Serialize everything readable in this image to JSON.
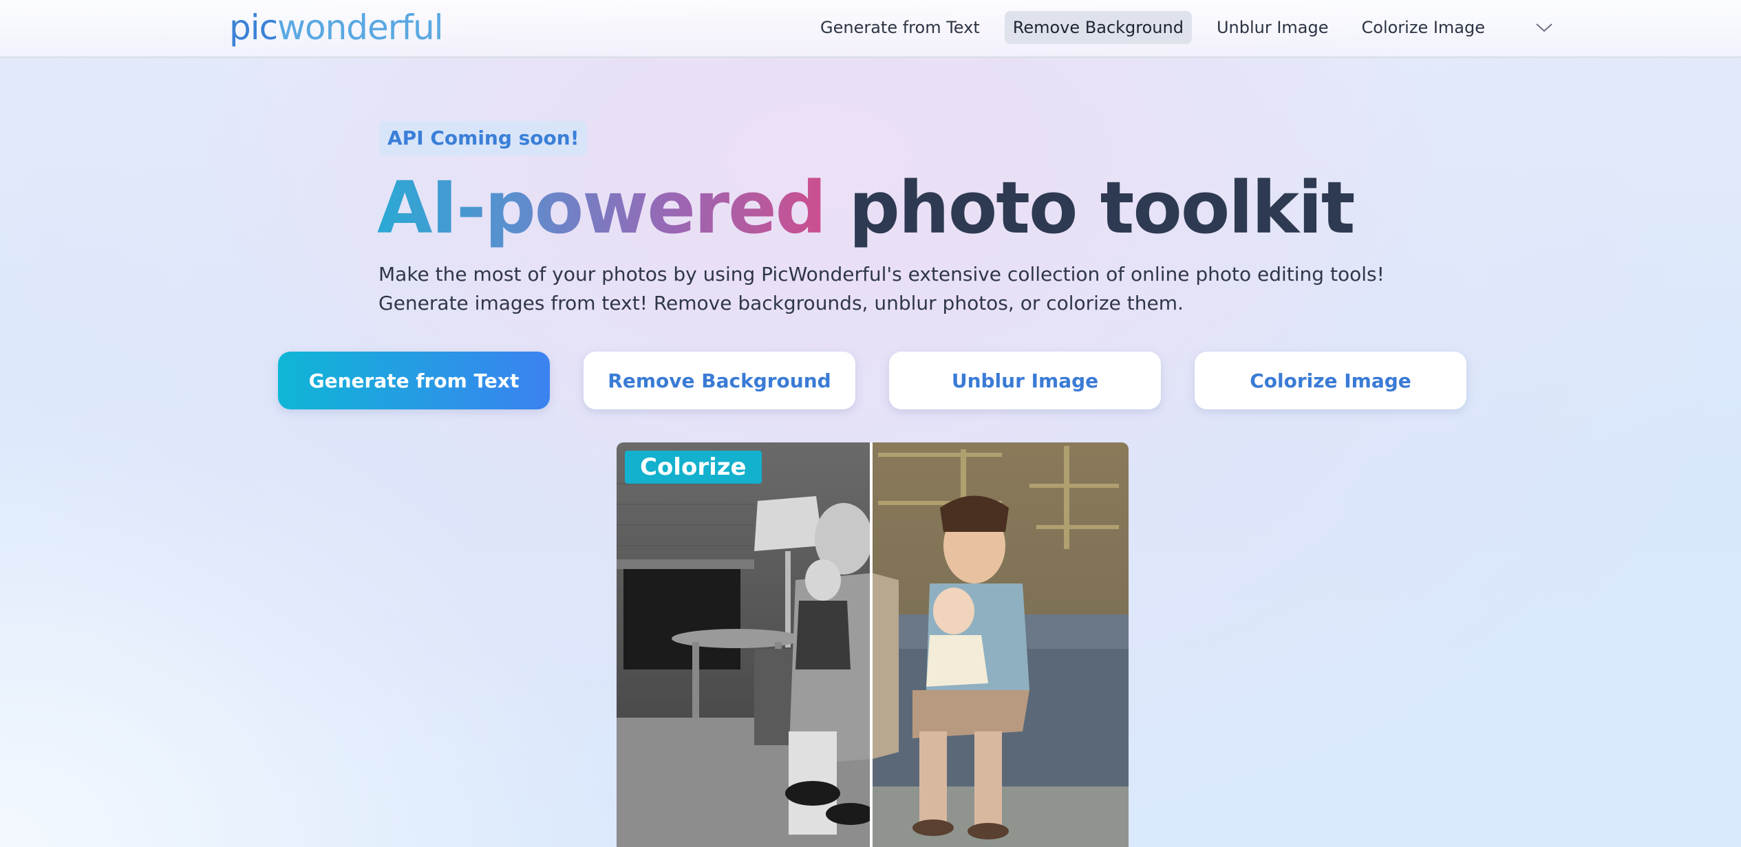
{
  "header": {
    "logo_pic": "pic",
    "logo_wonderful": "wonderful",
    "nav": [
      {
        "label": "Generate from Text",
        "active": false
      },
      {
        "label": "Remove Background",
        "active": true
      },
      {
        "label": "Unblur Image",
        "active": false
      },
      {
        "label": "Colorize Image",
        "active": false
      }
    ],
    "more_icon": "chevron-down-icon"
  },
  "hero": {
    "badge": "API Coming soon!",
    "headline_gradient": "AI-powered",
    "headline_rest": "photo toolkit",
    "subtitle_line1": "Make the most of your photos by using PicWonderful's extensive collection of online photo editing tools!",
    "subtitle_line2": "Generate images from text! Remove backgrounds, unblur photos, or colorize them."
  },
  "actions": [
    {
      "label": "Generate from Text",
      "style": "primary"
    },
    {
      "label": "Remove Background",
      "style": "secondary"
    },
    {
      "label": "Unblur Image",
      "style": "secondary"
    },
    {
      "label": "Colorize Image",
      "style": "secondary"
    }
  ],
  "preview": {
    "tag": "Colorize"
  },
  "colors": {
    "accent": "#3a7bd5",
    "primary_gradient_start": "#0fb6d6",
    "primary_gradient_end": "#3b82f0",
    "tag_bg": "#13b1cd",
    "headline_dark": "#2e3a52"
  }
}
